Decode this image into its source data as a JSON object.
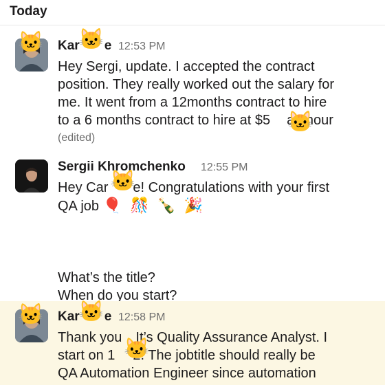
{
  "day_label": "Today",
  "messages": [
    {
      "author": "Karolyne",
      "author_shown": "Kar",
      "author_tail": "e",
      "time": "12:53 PM",
      "lines": [
        "Hey Sergi, update. I accepted the contract",
        "position. They really worked out the salary for",
        "me. It went from a 12months contract to hire",
        "to a 6 months contract to hire at $5",
        "an hour"
      ],
      "edited": "(edited)"
    },
    {
      "author": "Sergii Khromchenko",
      "time": "12:55 PM",
      "line1_a": "Hey Car",
      "line1_b": "e! Congratulations with your first",
      "line2": "QA job",
      "emojis": "🎈🎊🍾🎉",
      "line3": "What’s the title?",
      "line4": "When do you start?"
    },
    {
      "author_shown": "Kar",
      "author_tail": "e",
      "time": "12:58 PM",
      "line1_a": "Thank you",
      "line1_b": "It’s Quality Assurance Analyst. I",
      "line2_a": "start on 1",
      "line2_b": "2. The jobtitle should really be",
      "line3": "QA Automation Engineer since automation"
    }
  ],
  "overlay_icon": "cat-face-icon",
  "colors": {
    "highlight": "#fcf7e3",
    "time": "#6e6e6e"
  }
}
